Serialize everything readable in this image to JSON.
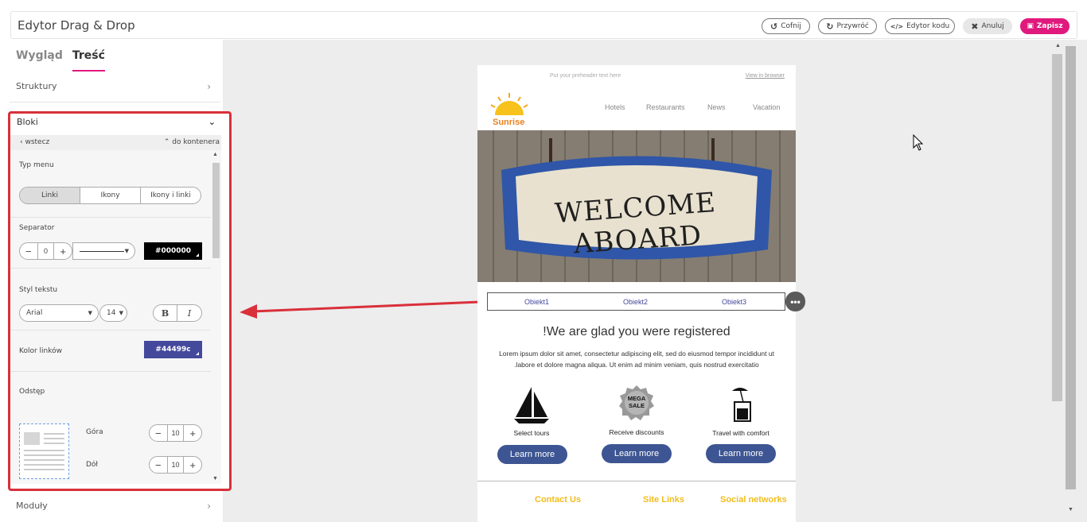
{
  "app": {
    "title": "Edytor Drag & Drop"
  },
  "toolbar": {
    "undo_label": "Cofnij",
    "redo_label": "Przywróć",
    "code_label": "Edytor kodu",
    "cancel_label": "Anuluj",
    "save_label": "Zapisz"
  },
  "sidebar": {
    "tabs": [
      {
        "label": "Wygląd"
      },
      {
        "label": "Treść"
      }
    ],
    "active_tab": "Treść",
    "structures_label": "Struktury",
    "blocks_label": "Bloki",
    "back_label": "wstecz",
    "container_label": "do kontenera",
    "menu_type": {
      "label": "Typ menu",
      "options": [
        "Linki",
        "Ikony",
        "Ikony i linki"
      ],
      "selected": "Linki"
    },
    "separator": {
      "label": "Separator",
      "width": "0",
      "color": "#000000"
    },
    "text_style": {
      "label": "Styl tekstu",
      "font": "Arial",
      "size": "14",
      "bold": "B",
      "italic": "I"
    },
    "link_color": {
      "label": "Kolor linków",
      "value": "#44499c"
    },
    "spacing": {
      "label": "Odstęp",
      "top_label": "Góra",
      "top_value": "10",
      "bottom_label": "Dół",
      "bottom_value": "10"
    },
    "modules_label": "Moduły"
  },
  "email": {
    "preheader": "Put your preheader text here",
    "view_in_browser": "View in browser",
    "logo_text": "Sunrise",
    "menu": [
      "Hotels",
      "Restaurants",
      "News",
      "Vacation"
    ],
    "hero_text": "WELCOME ABOARD",
    "objects": [
      "Obiekt1",
      "Obiekt2",
      "Obiekt3"
    ],
    "headline": "!We are glad you were registered",
    "body_line1": "Lorem ipsum dolor sit amet, consectetur adipiscing elit, sed do eiusmod tempor incididunt ut",
    "body_line2": ".labore et dolore magna aliqua. Ut enim ad minim veniam, quis nostrud exercitatio",
    "features": [
      {
        "label": "Select tours",
        "icon": "sailboat-icon",
        "button": "Learn more"
      },
      {
        "label": "Receive discounts",
        "icon": "mega-sale-badge-icon",
        "button": "Learn more"
      },
      {
        "label": "Travel with comfort",
        "icon": "cocktail-icon",
        "button": "Learn more"
      }
    ],
    "mega_sale": "MEGA SALE",
    "footer": [
      "Contact Us",
      "Site Links",
      "Social networks"
    ]
  },
  "colors": {
    "accent": "#e0197d",
    "link": "#44499c",
    "button": "#3d5592",
    "footer_link": "#f2bd1c",
    "highlight": "#d9303a"
  }
}
